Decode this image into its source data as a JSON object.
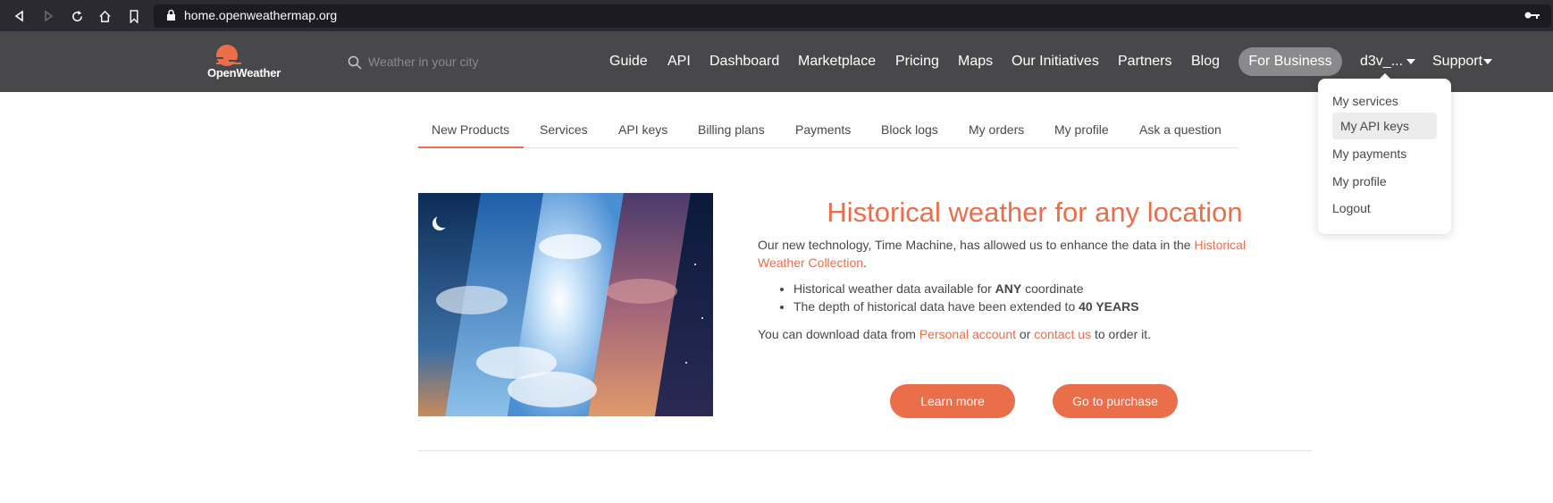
{
  "browser": {
    "url": "home.openweathermap.org"
  },
  "header": {
    "logo_text": "OpenWeather",
    "search_placeholder": "Weather in your city",
    "nav": [
      "Guide",
      "API",
      "Dashboard",
      "Marketplace",
      "Pricing",
      "Maps",
      "Our Initiatives",
      "Partners",
      "Blog"
    ],
    "for_business": "For Business",
    "user": "d3v_...",
    "support": "Support"
  },
  "user_menu": {
    "items": [
      "My services",
      "My API keys",
      "My payments",
      "My profile",
      "Logout"
    ],
    "highlighted": "My API keys"
  },
  "tabs": {
    "items": [
      "New Products",
      "Services",
      "API keys",
      "Billing plans",
      "Payments",
      "Block logs",
      "My orders",
      "My profile",
      "Ask a question"
    ],
    "active": "New Products"
  },
  "content": {
    "headline": "Historical weather for any location",
    "intro_before": "Our new technology, Time Machine, has allowed us to enhance the data in the ",
    "intro_link": "Historical Weather Collection",
    "intro_after": ".",
    "bullet1_before": "Historical weather data available for ",
    "bullet1_bold": "ANY",
    "bullet1_after": " coordinate",
    "bullet2_before": "The depth of historical data have been extended to ",
    "bullet2_bold": "40 YEARS",
    "download_before": "You can download data from ",
    "download_link1": "Personal account",
    "download_mid": " or ",
    "download_link2": "contact us",
    "download_after": " to order it.",
    "learn_more": "Learn more",
    "purchase": "Go to purchase"
  },
  "colors": {
    "accent": "#eb6e4b",
    "header_bg": "#48484a"
  }
}
